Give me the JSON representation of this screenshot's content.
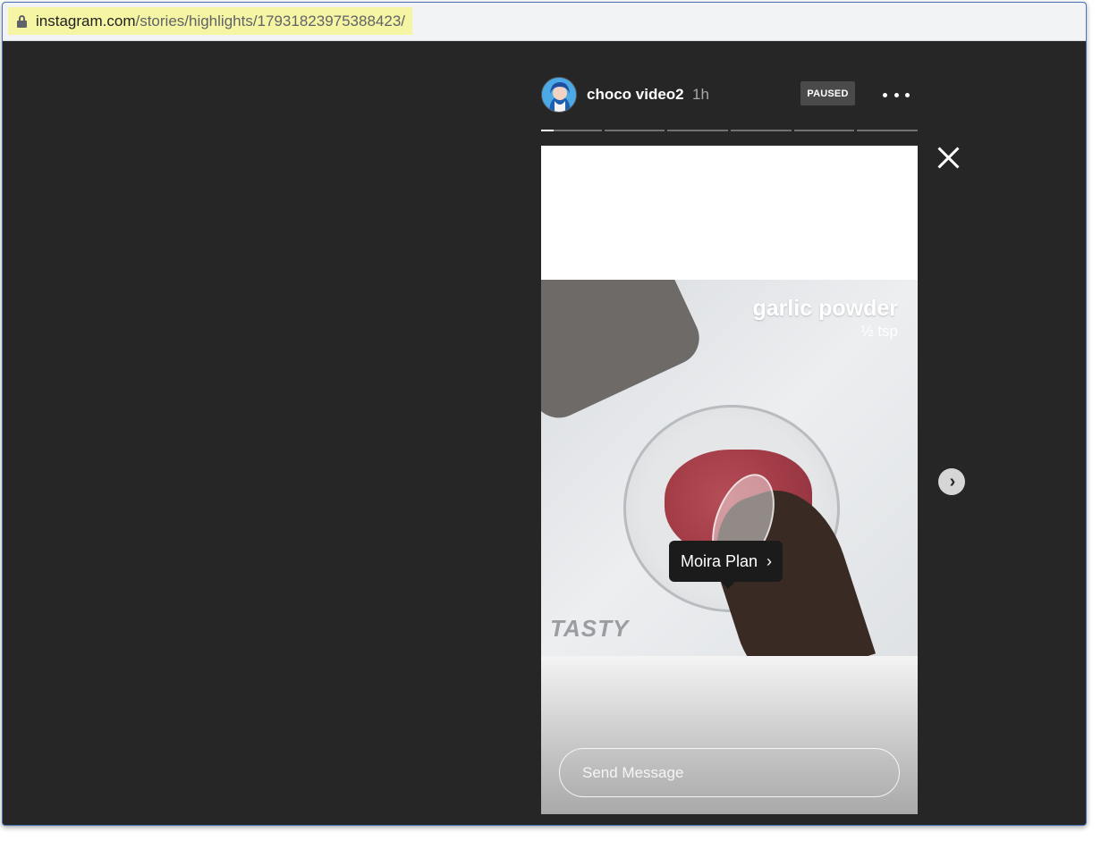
{
  "browser": {
    "url_domain": "instagram.com",
    "url_path": "/stories/highlights/17931823975388423/",
    "lock_icon": "lock-icon"
  },
  "story": {
    "username": "choco video2",
    "time_ago": "1h",
    "status_badge": "PAUSED",
    "progress_segments": [
      0.2,
      0,
      0,
      0,
      0,
      0
    ],
    "caption_title": "garlic powder",
    "caption_amount": "½ tsp",
    "watermark": "TASTY",
    "product_tag": "Moira Plan",
    "message_placeholder": "Send Message"
  },
  "icons": {
    "more": "more-options-icon",
    "close": "close-icon",
    "next": "chevron-right-icon"
  }
}
